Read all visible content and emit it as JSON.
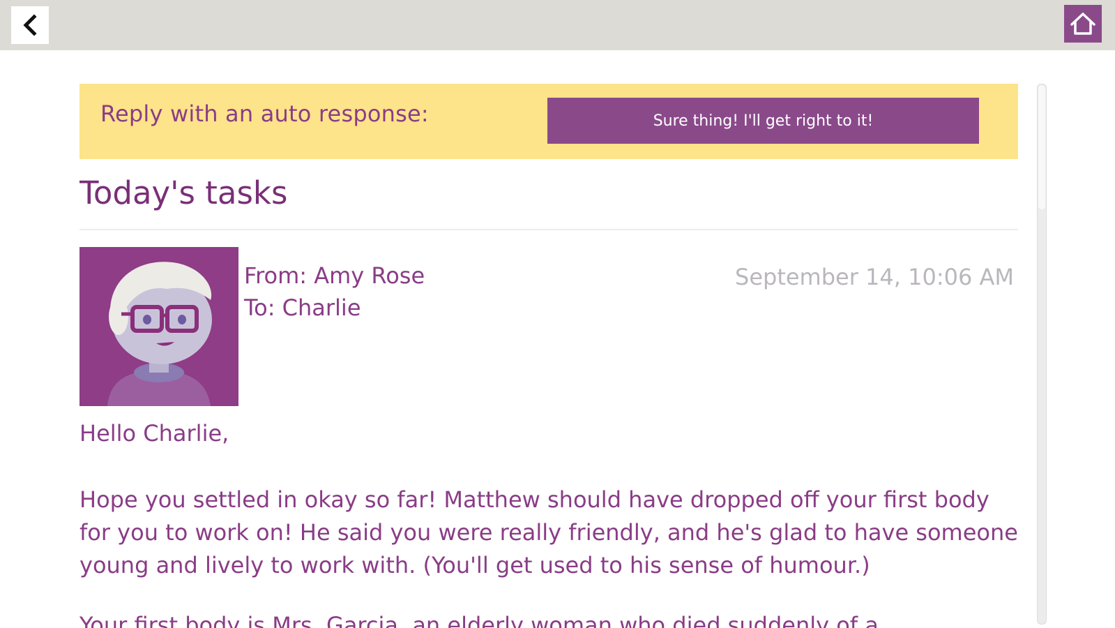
{
  "topbar": {
    "back_icon": "chevron-left-icon",
    "home_icon": "home-icon"
  },
  "banner": {
    "label": "Reply with an auto response:",
    "button_label": "Sure thing! I'll get right to it!"
  },
  "section": {
    "title": "Today's tasks"
  },
  "message": {
    "from": "From: Amy Rose",
    "to": "To: Charlie",
    "date": "September 14, 10:06 AM",
    "greeting": "Hello Charlie,",
    "paragraph": "Hope you settled in okay so far! Matthew should have dropped off your first body for you to work on! He said you were really friendly, and he's glad to have someone young and lively to work with. (You'll get used to his sense of humour.)",
    "paragraph_cutoff": "Your first body is Mrs. Garcia, an elderly woman who died suddenly of a"
  },
  "colors": {
    "accent_purple": "#8a4a8a",
    "text_purple": "#8a3c86",
    "banner_yellow": "#fde38a",
    "topbar_gray": "#dcdbd5"
  }
}
